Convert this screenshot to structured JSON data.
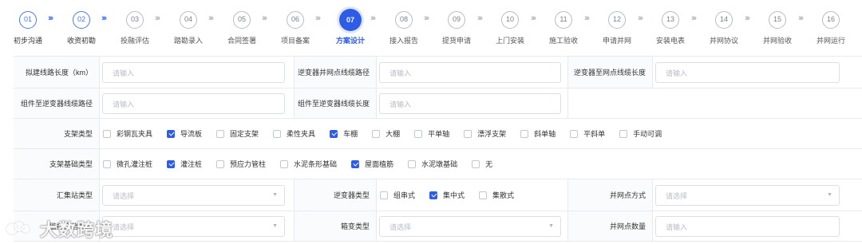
{
  "steps": [
    {
      "num": "01",
      "label": "初步沟通",
      "state": "done"
    },
    {
      "num": "02",
      "label": "收资初勘",
      "state": "done"
    },
    {
      "num": "03",
      "label": "投融评估",
      "state": "todo"
    },
    {
      "num": "04",
      "label": "踏勘录入",
      "state": "todo"
    },
    {
      "num": "05",
      "label": "合同签署",
      "state": "todo"
    },
    {
      "num": "06",
      "label": "项目备案",
      "state": "todo"
    },
    {
      "num": "07",
      "label": "方案设计",
      "state": "active"
    },
    {
      "num": "08",
      "label": "接入报告",
      "state": "todo"
    },
    {
      "num": "09",
      "label": "提货申请",
      "state": "todo"
    },
    {
      "num": "10",
      "label": "上门安装",
      "state": "todo"
    },
    {
      "num": "11",
      "label": "施工验收",
      "state": "todo"
    },
    {
      "num": "12",
      "label": "申请并网",
      "state": "todo"
    },
    {
      "num": "13",
      "label": "安装电表",
      "state": "todo"
    },
    {
      "num": "14",
      "label": "并网协议",
      "state": "todo"
    },
    {
      "num": "15",
      "label": "并网验收",
      "state": "todo"
    },
    {
      "num": "16",
      "label": "并网运行",
      "state": "todo"
    }
  ],
  "chevron": "›››",
  "form": {
    "row1": {
      "label1": "拟建线路长度（km）",
      "placeholder1": "请输入",
      "label2": "逆变器并网点线缆路径",
      "placeholder2": "请输入",
      "label3": "逆变器至网点线缆长度",
      "placeholder3": "请输入"
    },
    "row2": {
      "label1": "组件至逆变器线缆路径",
      "placeholder1": "请输入",
      "label2": "组件至逆变器线缆长度",
      "placeholder2": "请输入"
    },
    "bracket_type": {
      "label": "支架类型",
      "options": [
        {
          "text": "彩钢瓦夹具",
          "checked": false
        },
        {
          "text": "导流板",
          "checked": true
        },
        {
          "text": "固定支架",
          "checked": false
        },
        {
          "text": "柔性夹具",
          "checked": false
        },
        {
          "text": "车棚",
          "checked": true
        },
        {
          "text": "大棚",
          "checked": false
        },
        {
          "text": "平单轴",
          "checked": false
        },
        {
          "text": "漂浮支架",
          "checked": false
        },
        {
          "text": "斜单轴",
          "checked": false
        },
        {
          "text": "平斜单",
          "checked": false
        },
        {
          "text": "手动可调",
          "checked": false
        }
      ]
    },
    "foundation_type": {
      "label": "支架基础类型",
      "options": [
        {
          "text": "微孔灌注桩",
          "checked": false
        },
        {
          "text": "灌注桩",
          "checked": true
        },
        {
          "text": "预应力管柱",
          "checked": false
        },
        {
          "text": "水泥条形基础",
          "checked": false
        },
        {
          "text": "屋面植筋",
          "checked": true
        },
        {
          "text": "水泥墩基础",
          "checked": false
        },
        {
          "text": "无",
          "checked": false
        }
      ]
    },
    "row5": {
      "label1": "汇集站类型",
      "placeholder1": "请选择",
      "label2": "逆变器类型",
      "inverter_options": [
        {
          "text": "组串式",
          "checked": false
        },
        {
          "text": "集中式",
          "checked": true
        },
        {
          "text": "集散式",
          "checked": false
        }
      ],
      "label3": "并网点方式",
      "placeholder3": "请选择"
    },
    "row6": {
      "label1": "监控通信方式",
      "placeholder1": "请选择",
      "label2": "箱变类型",
      "placeholder2": "请选择",
      "label3": "并网点数量",
      "placeholder3": "请输入"
    }
  },
  "watermark": "大数跨境",
  "colors": {
    "primary": "#2f5ce6",
    "done": "#4a78f2",
    "todo": "#b8bcc6"
  }
}
